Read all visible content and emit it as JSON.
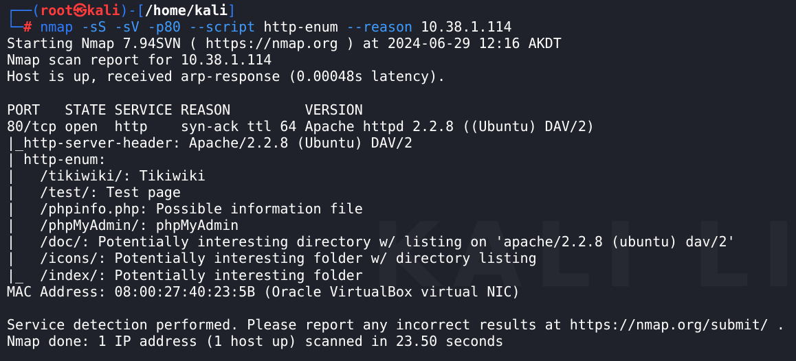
{
  "prompt": {
    "open_bracket": "┌──(",
    "user": "root",
    "at_symbol": "㉿",
    "host": "kali",
    "mid_bracket": ")-[",
    "cwd": "/home/kali",
    "close_bracket": "]",
    "bottom_bracket": "└─",
    "hash": "#"
  },
  "command": {
    "program": "nmap",
    "args": "-sS -sV -p80 --script",
    "script_name": "http-enum",
    "flag": "--reason",
    "target": "10.38.1.114"
  },
  "output": [
    "Starting Nmap 7.94SVN ( https://nmap.org ) at 2024-06-29 12:16 AKDT",
    "Nmap scan report for 10.38.1.114",
    "Host is up, received arp-response (0.00048s latency).",
    "",
    "PORT   STATE SERVICE REASON         VERSION",
    "80/tcp open  http    syn-ack ttl 64 Apache httpd 2.2.8 ((Ubuntu) DAV/2)",
    "|_http-server-header: Apache/2.2.8 (Ubuntu) DAV/2",
    "| http-enum: ",
    "|   /tikiwiki/: Tikiwiki",
    "|   /test/: Test page",
    "|   /phpinfo.php: Possible information file",
    "|   /phpMyAdmin/: phpMyAdmin",
    "|   /doc/: Potentially interesting directory w/ listing on 'apache/2.2.8 (ubuntu) dav/2'",
    "|   /icons/: Potentially interesting folder w/ directory listing",
    "|_  /index/: Potentially interesting folder",
    "MAC Address: 08:00:27:40:23:5B (Oracle VirtualBox virtual NIC)",
    "",
    "Service detection performed. Please report any incorrect results at https://nmap.org/submit/ .",
    "Nmap done: 1 IP address (1 host up) scanned in 23.50 seconds"
  ],
  "colors": {
    "background": "#1f222a",
    "prompt_blue": "#2f7dff",
    "user_red": "#ff3b3b",
    "text": "#ffffff"
  }
}
